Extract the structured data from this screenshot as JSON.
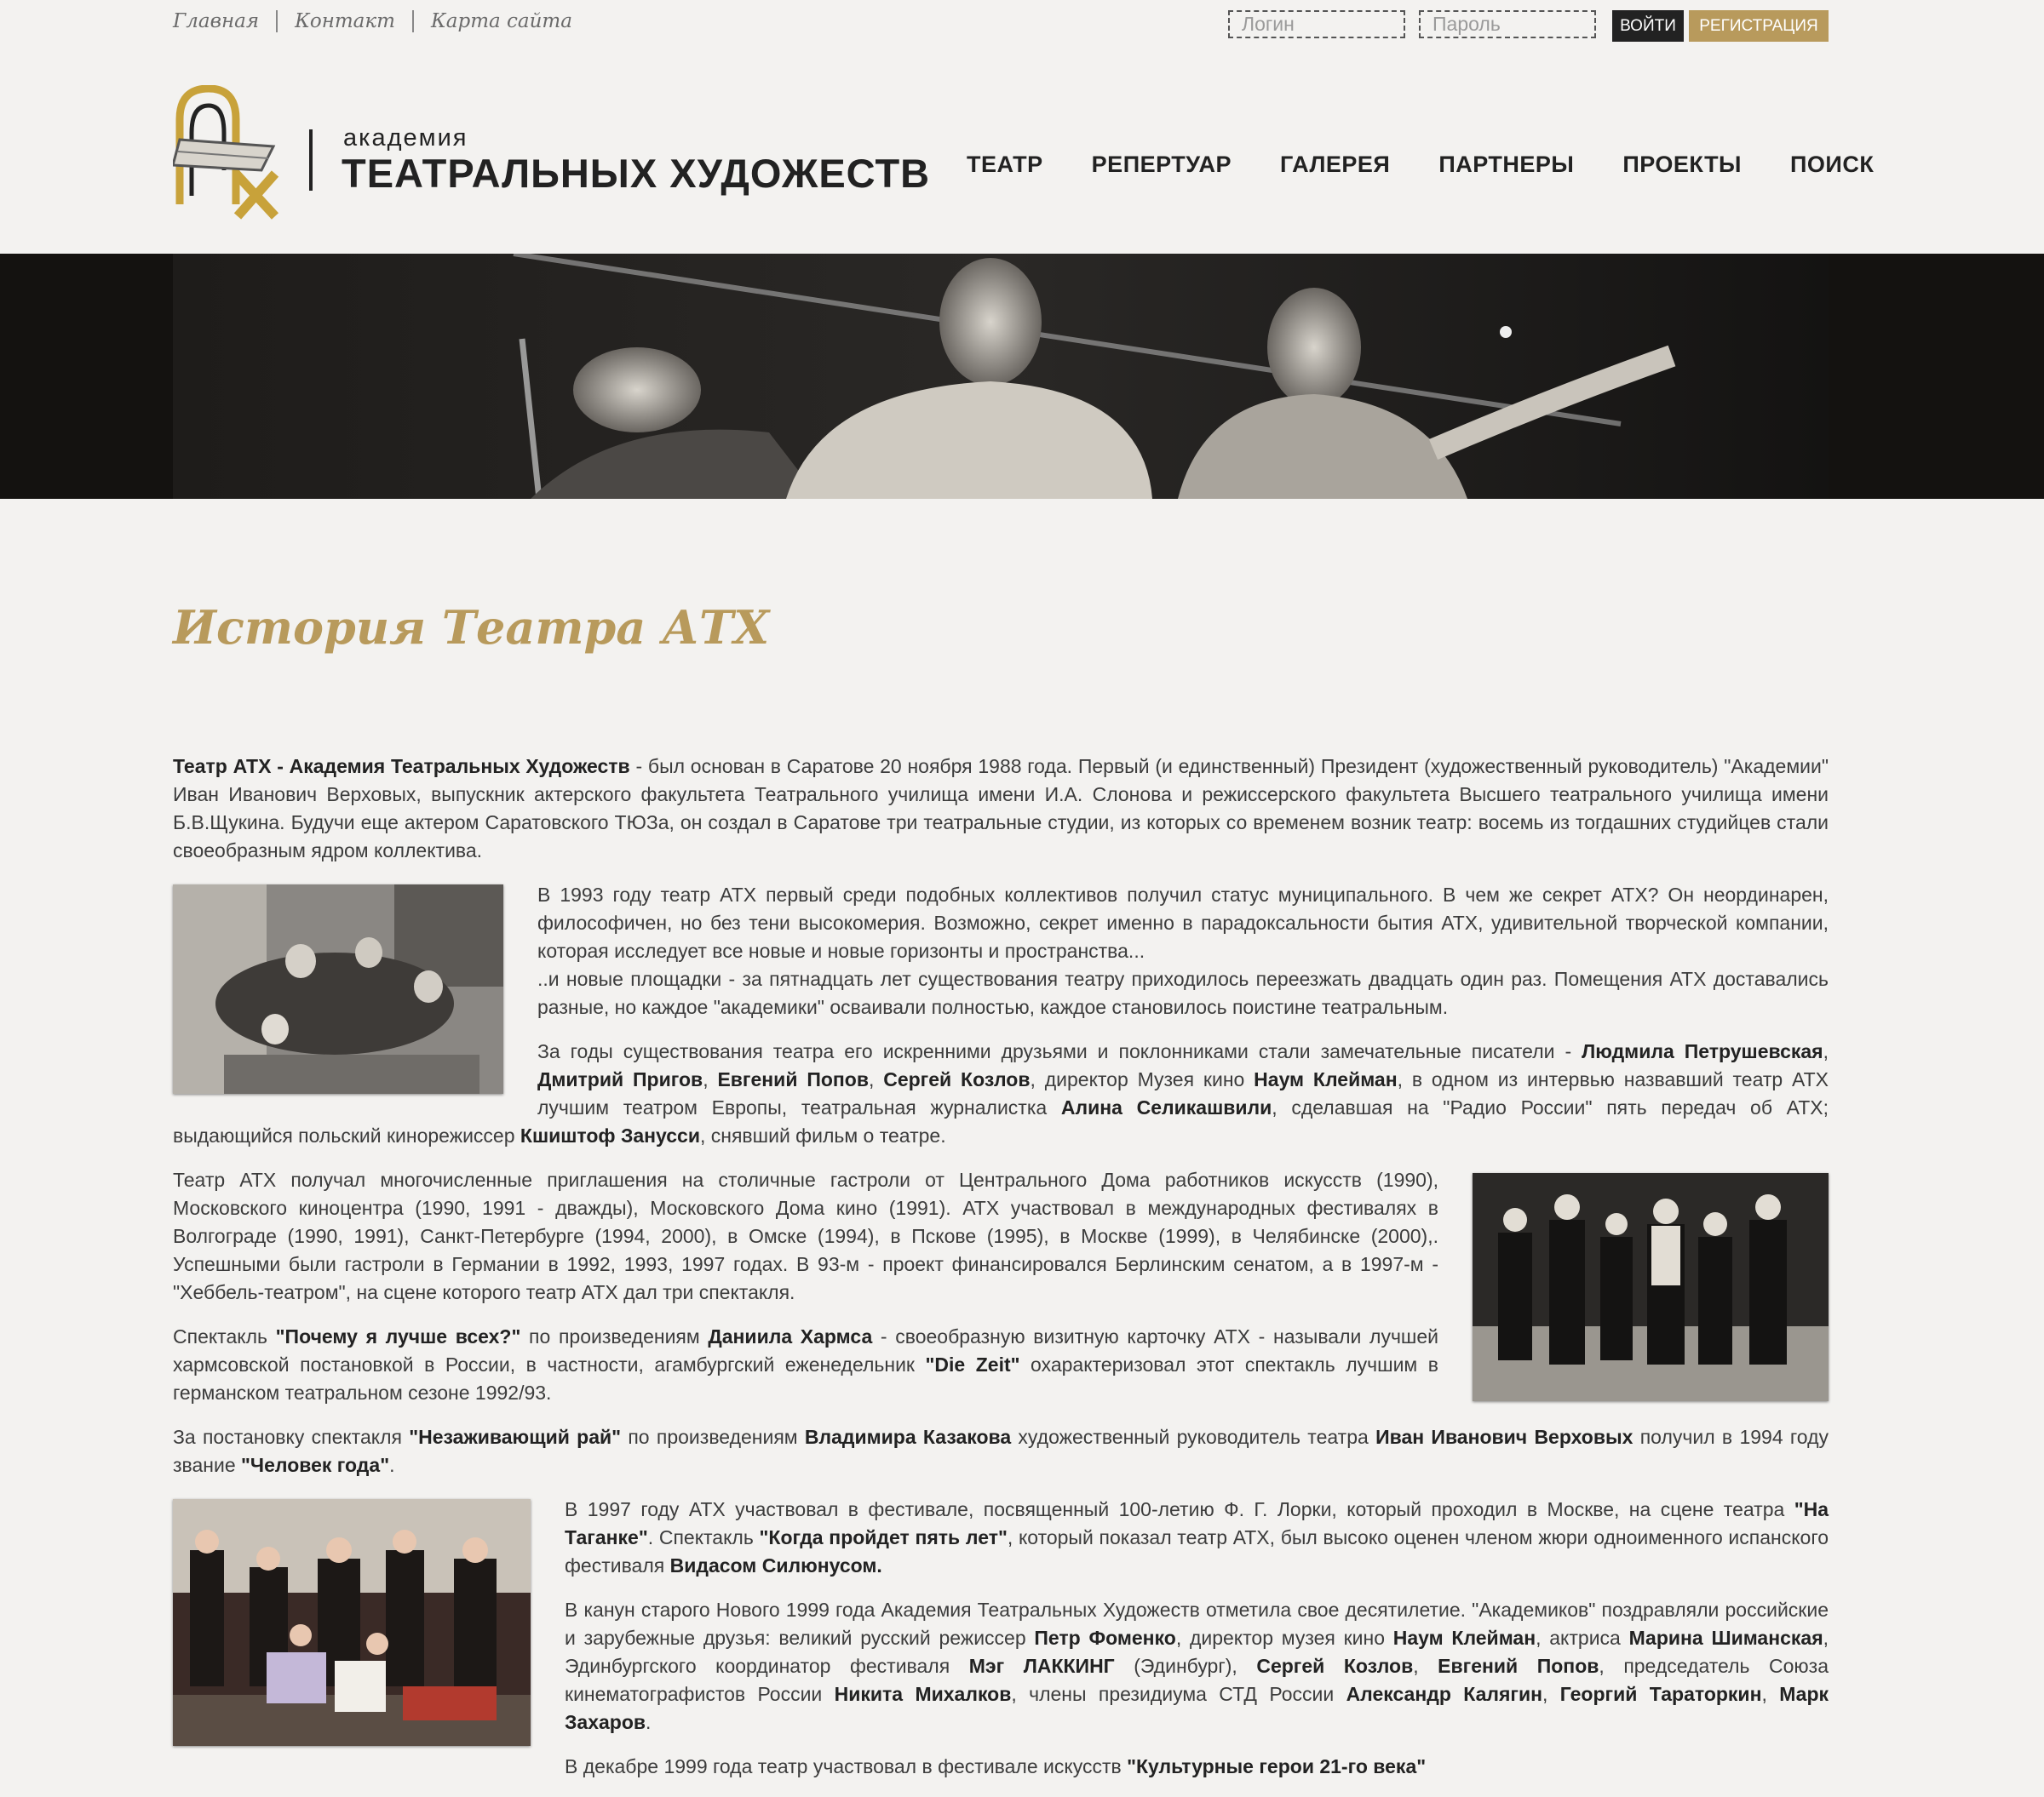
{
  "top_links": [
    "Главная",
    "Контакт",
    "Карта сайта"
  ],
  "login": {
    "login_placeholder": "Логин",
    "password_placeholder": "Пароль",
    "login_button": "ВОЙТИ",
    "register_button": "РЕГИСТРАЦИЯ"
  },
  "logo": {
    "small": "академия",
    "big": "ТЕАТРАЛЬНЫХ ХУДОЖЕСТВ"
  },
  "nav": [
    "ТЕАТР",
    "РЕПЕРТУАР",
    "ГАЛЕРЕЯ",
    "ПАРТНЕРЫ",
    "ПРОЕКТЫ",
    "ПОИСК"
  ],
  "title": "История Театра АТХ",
  "colors": {
    "accent": "#b89a5c",
    "dark": "#222222",
    "background": "#f3f2f0"
  },
  "paragraphs": [
    [
      {
        "b": "Театр АТХ - Академия Театральных Художеств"
      },
      {
        "t": " - был основан в Саратове 20 ноября 1988 года. Первый (и единственный) Президент (художественный руководитель) \"Академии\" Иван Иванович Верховых, выпускник актерского факультета Театрального училища имени И.А.  Слонова и режиссерского факультета Высшего театрального училища имени Б.В.Щукина. Будучи еще актером Саратовского ТЮЗа, он создал в Саратове три театральные студии, из которых со временем возник театр: восемь из тогдашних студийцев стали своеобразным ядром коллектива."
      }
    ],
    [
      {
        "t": "В 1993 году театр АТХ первый среди подобных коллективов получил статус муниципального. В чем же секрет АТХ? Он неординарен, философичен, но без тени высокомерия. Возможно, секрет именно в парадоксальности бытия АТХ, удивительной творческой компании, которая исследует все новые и новые горизонты и пространства..."
      },
      {
        "br": 1
      },
      {
        "t": "..и новые площадки - за пятнадцать лет существования театру приходилось переезжать двадцать один раз. Помещения АТХ доставались разные, но каждое \"академики\" осваивали полностью, каждое становилось поистине театральным."
      }
    ],
    [
      {
        "t": "За годы существования театра его искренними друзьями и поклонниками стали замечательные писатели - "
      },
      {
        "b": "Людмила Петрушевская"
      },
      {
        "t": ", "
      },
      {
        "b": "Дмитрий Пригов"
      },
      {
        "t": ", "
      },
      {
        "b": "Евгений Попов"
      },
      {
        "t": ", "
      },
      {
        "b": "Сергей Козлов"
      },
      {
        "t": ", директор Музея кино "
      },
      {
        "b": "Наум Клейман"
      },
      {
        "t": ", в одном из интервью назвавший театр АТХ лучшим театром Европы, театральная журналистка "
      },
      {
        "b": "Алина Селикашвили"
      },
      {
        "t": ", сделавшая на \"Радио России\" пять передач об АТХ; выдающийся польский кинорежиссер "
      },
      {
        "b": "Кшиштоф Занусси"
      },
      {
        "t": ", снявший фильм о театре."
      }
    ],
    [
      {
        "t": "Театр АТХ получал многочисленные приглашения на столичные гастроли от Центрального Дома работников искусств (1990), Московского киноцентра (1990, 1991 - дважды), Московского Дома кино (1991). АТХ участвовал в международных фестивалях в Волгограде (1990, 1991), Санкт-Петербурге (1994, 2000), в Омске (1994), в Пскове (1995), в Москве (1999), в Челябинске (2000),. Успешными были гастроли в Германии в 1992, 1993, 1997 годах. В 93-м - проект финансировался Берлинским сенатом, а в 1997-м - \"Хеббель-театром\", на сцене которого театр АТХ дал три спектакля."
      }
    ],
    [
      {
        "t": "Спектакль "
      },
      {
        "b": "\"Почему я лучше всех?\""
      },
      {
        "t": " по произведениям "
      },
      {
        "b": "Даниила Хармса"
      },
      {
        "t": " - своеобразную визитную карточку АТХ - называли лучшей хармсовской постановкой в России, в частности, агамбургский еженедельник "
      },
      {
        "b": "\"Die Zeit\""
      },
      {
        "t": " охарактеризовал этот спектакль лучшим в германском театральном сезоне 1992/93."
      }
    ],
    [
      {
        "t": "За постановку спектакля "
      },
      {
        "b": "\"Незаживающий рай\""
      },
      {
        "t": " по произведениям "
      },
      {
        "b": "Владимира Казакова"
      },
      {
        "t": " художественный руководитель театра "
      },
      {
        "b": "Иван Иванович Верховых"
      },
      {
        "t": " получил в 1994 году звание "
      },
      {
        "b": "\"Человек года\""
      },
      {
        "t": "."
      }
    ],
    [
      {
        "t": "В 1997 году АТХ участвовал в фестивале, посвященный 100-летию Ф. Г. Лорки, который проходил в Москве, на сцене театра "
      },
      {
        "b": "\"На Таганке\""
      },
      {
        "t": ". Спектакль "
      },
      {
        "b": "\"Когда пройдет пять лет\""
      },
      {
        "t": ", который показал театр АТХ, был высоко оценен членом жюри одноименного испанского фестиваля "
      },
      {
        "b": "Видасом Силюнусом."
      }
    ],
    [
      {
        "t": "В канун старого Нового 1999 года Академия Театральных Художеств отметила свое десятилетие. \"Академиков\" поздравляли российские и зарубежные друзья: великий русский режиссер "
      },
      {
        "b": "Петр Фоменко"
      },
      {
        "t": ",  директор музея кино "
      },
      {
        "b": "Наум Клейман"
      },
      {
        "t": ", актриса "
      },
      {
        "b": "Марина Шиманская"
      },
      {
        "t": ", Эдинбургского координатор фестиваля "
      },
      {
        "b": "Мэг ЛАККИНГ"
      },
      {
        "t": " (Эдинбург), "
      },
      {
        "b": "Сергей Козлов"
      },
      {
        "t": ", "
      },
      {
        "b": "Евгений Попов"
      },
      {
        "t": ", председатель Союза кинематографистов России "
      },
      {
        "b": "Никита Михалков"
      },
      {
        "t": ", члены президиума СТД России "
      },
      {
        "b": "Александр Калягин"
      },
      {
        "t": ", "
      },
      {
        "b": "Георгий Тараторкин"
      },
      {
        "t": ", "
      },
      {
        "b": "Марк Захаров"
      },
      {
        "t": "."
      }
    ],
    [
      {
        "t": "В декабре 1999 года театр участвовал в фестивале искусств "
      },
      {
        "b": "\"Культурные герои 21-го века\""
      }
    ]
  ]
}
